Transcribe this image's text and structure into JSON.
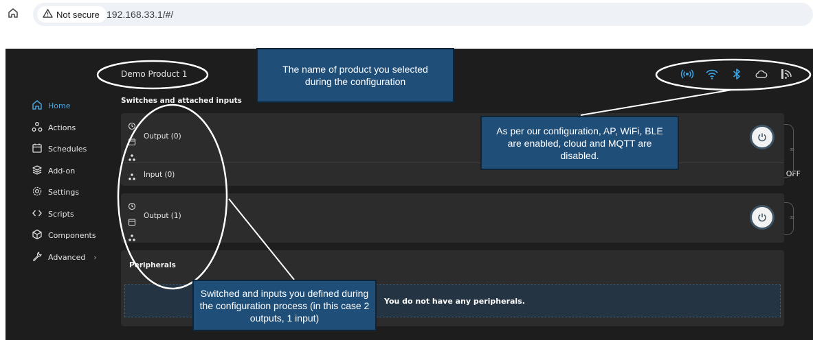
{
  "browser": {
    "security_label": "Not secure",
    "url": "192.168.33.1/#/"
  },
  "header": {
    "product_name": "Demo Product 1",
    "status_icons": [
      "ap-icon",
      "wifi-icon",
      "bluetooth-icon",
      "cloud-icon",
      "mqtt-icon"
    ]
  },
  "sidebar": {
    "items": [
      {
        "label": "Home",
        "icon": "home-icon",
        "active": true
      },
      {
        "label": "Actions",
        "icon": "actions-icon"
      },
      {
        "label": "Schedules",
        "icon": "calendar-icon"
      },
      {
        "label": "Add-on",
        "icon": "layers-icon"
      },
      {
        "label": "Settings",
        "icon": "gear-icon"
      },
      {
        "label": "Scripts",
        "icon": "code-icon"
      },
      {
        "label": "Components",
        "icon": "cube-icon"
      },
      {
        "label": "Advanced",
        "icon": "wrench-icon",
        "has_submenu": true
      }
    ]
  },
  "main": {
    "section_title": "Switches and attached inputs",
    "output0_label": "Output (0)",
    "input0_label": "Input (0)",
    "output1_label": "Output (1)",
    "output0_state": "OFF",
    "peripherals_title": "Peripherals",
    "peripherals_empty": "You do not have any peripherals."
  },
  "annotations": {
    "product_callout": "The name of product you selected during the configuration",
    "status_callout": "As per our configuration, AP, WiFi, BLE are enabled, cloud and MQTT are disabled.",
    "switches_callout": "Switched and inputs you defined during the configuration process (in this case 2 outputs, 1 input)"
  },
  "colors": {
    "accent": "#4aa3d9",
    "app_background": "#1d1d1d",
    "card_background": "#2c2c2c",
    "callout_background": "#1f4e79"
  }
}
